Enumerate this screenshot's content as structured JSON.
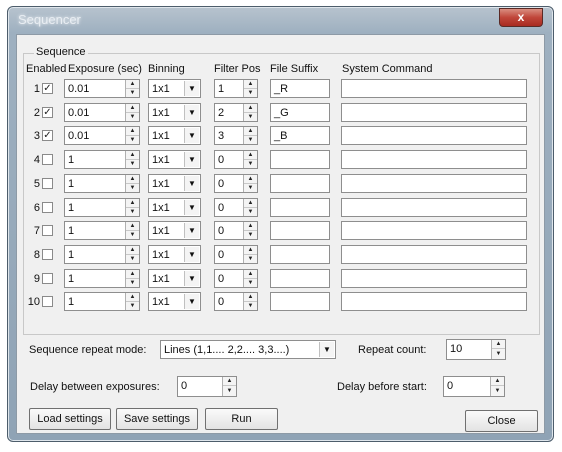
{
  "window": {
    "title": "Sequencer",
    "close_label": "x"
  },
  "sequence": {
    "legend": "Sequence",
    "headers": {
      "enabled": "Enabled",
      "exposure": "Exposure (sec)",
      "binning": "Binning",
      "filter_pos": "Filter Pos",
      "file_suffix": "File Suffix",
      "system_command": "System Command"
    },
    "rows": [
      {
        "num": "1",
        "enabled": true,
        "exposure": "0.01",
        "binning": "1x1",
        "filter_pos": "1",
        "file_suffix": "_R",
        "command": ""
      },
      {
        "num": "2",
        "enabled": true,
        "exposure": "0.01",
        "binning": "1x1",
        "filter_pos": "2",
        "file_suffix": "_G",
        "command": ""
      },
      {
        "num": "3",
        "enabled": true,
        "exposure": "0.01",
        "binning": "1x1",
        "filter_pos": "3",
        "file_suffix": "_B",
        "command": ""
      },
      {
        "num": "4",
        "enabled": false,
        "exposure": "1",
        "binning": "1x1",
        "filter_pos": "0",
        "file_suffix": "",
        "command": ""
      },
      {
        "num": "5",
        "enabled": false,
        "exposure": "1",
        "binning": "1x1",
        "filter_pos": "0",
        "file_suffix": "",
        "command": ""
      },
      {
        "num": "6",
        "enabled": false,
        "exposure": "1",
        "binning": "1x1",
        "filter_pos": "0",
        "file_suffix": "",
        "command": ""
      },
      {
        "num": "7",
        "enabled": false,
        "exposure": "1",
        "binning": "1x1",
        "filter_pos": "0",
        "file_suffix": "",
        "command": ""
      },
      {
        "num": "8",
        "enabled": false,
        "exposure": "1",
        "binning": "1x1",
        "filter_pos": "0",
        "file_suffix": "",
        "command": ""
      },
      {
        "num": "9",
        "enabled": false,
        "exposure": "1",
        "binning": "1x1",
        "filter_pos": "0",
        "file_suffix": "",
        "command": ""
      },
      {
        "num": "10",
        "enabled": false,
        "exposure": "1",
        "binning": "1x1",
        "filter_pos": "0",
        "file_suffix": "",
        "command": ""
      }
    ]
  },
  "settings": {
    "repeat_mode_label": "Sequence repeat mode:",
    "repeat_mode_value": "Lines (1,1.... 2,2.... 3,3....)",
    "repeat_count_label": "Repeat count:",
    "repeat_count_value": "10",
    "delay_between_label": "Delay between exposures:",
    "delay_between_value": "0",
    "delay_before_label": "Delay before start:",
    "delay_before_value": "0"
  },
  "buttons": {
    "load": "Load settings",
    "save": "Save settings",
    "run": "Run",
    "close": "Close"
  }
}
